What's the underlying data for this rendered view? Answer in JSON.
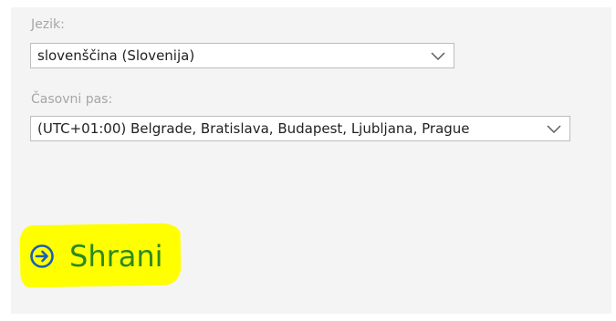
{
  "language": {
    "label": "Jezik:",
    "value": "slovenščina (Slovenija)"
  },
  "timezone": {
    "label": "Časovni pas:",
    "value": "(UTC+01:00) Belgrade, Bratislava, Budapest, Ljubljana, Prague"
  },
  "save": {
    "label": "Shrani",
    "icon": "arrow-circle-right-icon"
  },
  "colors": {
    "panel_bg": "#f4f4f4",
    "label_gray": "#a6a6a6",
    "save_green": "#2b8a1e",
    "icon_blue": "#1a5fb4",
    "highlight_yellow": "#ffff00"
  }
}
